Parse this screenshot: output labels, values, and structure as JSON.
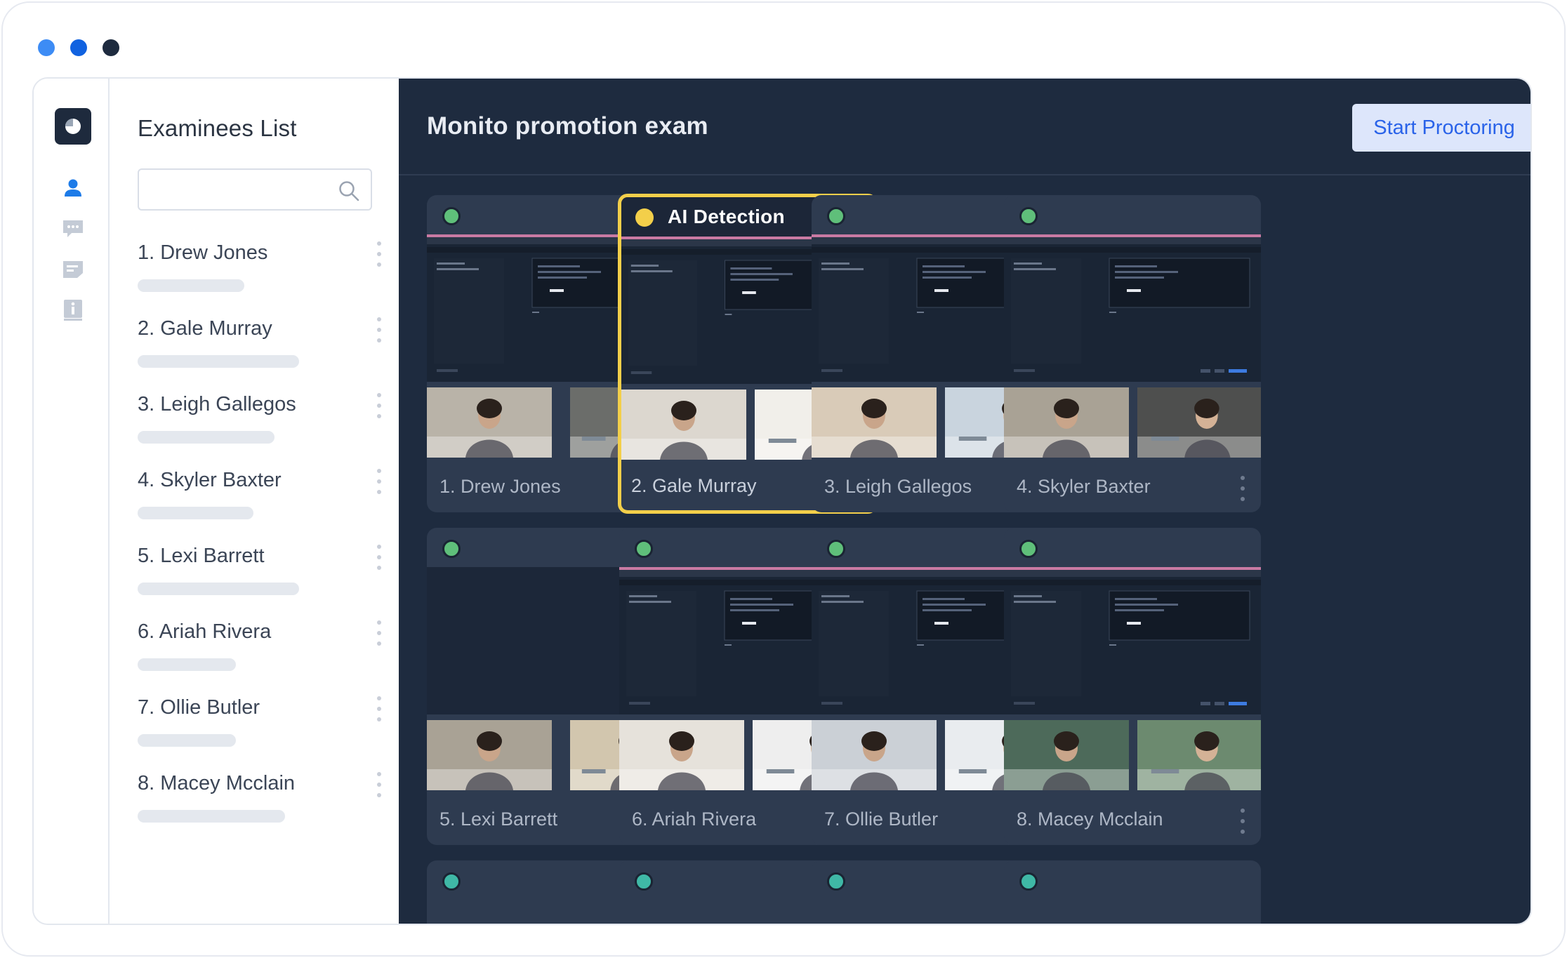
{
  "window": {
    "traffic_lights": [
      "#3d8cf5",
      "#1162e0",
      "#1e2b3f"
    ]
  },
  "rail": {
    "logo_icon": "pie-chart-icon",
    "items": [
      {
        "icon": "person-icon",
        "active": true
      },
      {
        "icon": "chat-bubble-icon",
        "active": false
      },
      {
        "icon": "notes-icon",
        "active": false
      },
      {
        "icon": "info-icon",
        "active": false
      }
    ]
  },
  "sidebar": {
    "title": "Examinees List",
    "search": {
      "value": "",
      "placeholder": ""
    },
    "examinees": [
      {
        "label": "1. Drew Jones"
      },
      {
        "label": "2. Gale Murray"
      },
      {
        "label": "3. Leigh Gallegos"
      },
      {
        "label": "4. Skyler Baxter"
      },
      {
        "label": "5. Lexi Barrett"
      },
      {
        "label": "6. Ariah Rivera"
      },
      {
        "label": "7. Ollie Butler"
      },
      {
        "label": "8. Macey Mcclain"
      }
    ]
  },
  "main": {
    "title": "Monito promotion exam",
    "start_button": "Start Proctoring",
    "tiles": [
      {
        "name": "1. Drew Jones",
        "status_color": "#5fbf7a",
        "alert": ""
      },
      {
        "name": "2. Gale Murray",
        "status_color": "#f3cf4a",
        "alert": "AI  Detection"
      },
      {
        "name": "3. Leigh Gallegos",
        "status_color": "#5fbf7a",
        "alert": ""
      },
      {
        "name": "4. Skyler Baxter",
        "status_color": "#5fbf7a",
        "alert": ""
      },
      {
        "name": "5. Lexi Barrett",
        "status_color": "#5fbf7a",
        "alert": ""
      },
      {
        "name": "6. Ariah Rivera",
        "status_color": "#5fbf7a",
        "alert": ""
      },
      {
        "name": "7. Ollie Butler",
        "status_color": "#5fbf7a",
        "alert": ""
      },
      {
        "name": "8. Macey Mcclain",
        "status_color": "#5fbf7a",
        "alert": ""
      },
      {
        "name": "",
        "status_color": "#3fb8a6",
        "alert": ""
      },
      {
        "name": "",
        "status_color": "#3fb8a6",
        "alert": ""
      },
      {
        "name": "",
        "status_color": "#3fb8a6",
        "alert": ""
      },
      {
        "name": "",
        "status_color": "#3fb8a6",
        "alert": ""
      }
    ]
  }
}
